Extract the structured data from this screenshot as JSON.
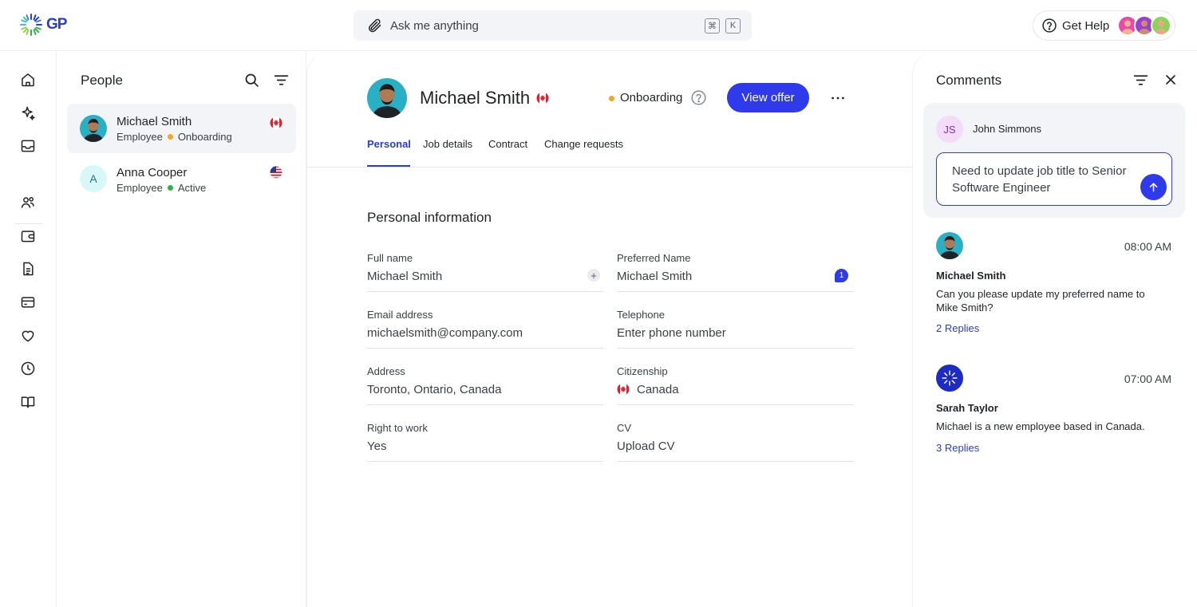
{
  "brand": {
    "logo_text": "GP",
    "accent": "#2f3bea"
  },
  "topbar": {
    "search_placeholder": "Ask me anything",
    "shortcut_keys": [
      "⌘",
      "K"
    ],
    "help_label": "Get Help"
  },
  "rail": {
    "icons": [
      "home-icon",
      "sparkle-icon",
      "inbox-icon",
      "people-icon",
      "wallet-icon",
      "document-icon",
      "card-icon",
      "heart-icon",
      "clock-icon",
      "book-icon"
    ]
  },
  "people_panel": {
    "title": "People",
    "people": [
      {
        "name": "Michael Smith",
        "role": "Employee",
        "status": "Onboarding",
        "status_color": "#f5a623",
        "flag": "canada",
        "avatar_initial": "",
        "selected": true
      },
      {
        "name": "Anna Cooper",
        "role": "Employee",
        "status": "Active",
        "status_color": "#2fb14b",
        "flag": "usa",
        "avatar_initial": "A",
        "selected": false
      }
    ]
  },
  "profile": {
    "name": "Michael Smith",
    "status": "Onboarding",
    "status_color": "#f5a623",
    "view_offer_label": "View offer",
    "tabs": [
      "Personal",
      "Job details",
      "Contract",
      "Change requests"
    ],
    "active_tab": "Personal",
    "section_title": "Personal information",
    "fields": {
      "full_name": {
        "label": "Full name",
        "value": "Michael Smith"
      },
      "preferred_name": {
        "label": "Preferred Name",
        "value": "Michael Smith",
        "comment_count": "1"
      },
      "email": {
        "label": "Email address",
        "value": "michaelsmith@company.com"
      },
      "telephone": {
        "label": "Telephone",
        "value": "Enter phone number"
      },
      "address": {
        "label": "Address",
        "value": "Toronto, Ontario, Canada"
      },
      "citizenship": {
        "label": "Citizenship",
        "value": "Canada"
      },
      "right_to_work": {
        "label": "Right to work",
        "value": "Yes"
      },
      "cv": {
        "label": "CV",
        "value": "Upload CV"
      }
    }
  },
  "comments": {
    "title": "Comments",
    "composer": {
      "author_initials": "JS",
      "author_name": "John Simmons",
      "draft_text": "Need to update job title to Senior Software Engineer"
    },
    "items": [
      {
        "author": "Michael Smith",
        "time": "08:00 AM",
        "text": "Can you please update my preferred name to Mike Smith?",
        "replies": "2 Replies"
      },
      {
        "author": "Sarah Taylor",
        "time": "07:00 AM",
        "text": "Michael is a new employee based in Canada.",
        "replies": "3 Replies"
      }
    ]
  }
}
